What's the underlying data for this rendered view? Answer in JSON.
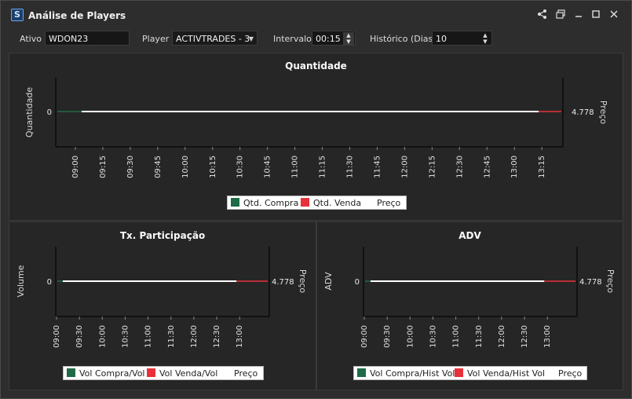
{
  "window": {
    "title": "Análise de Players"
  },
  "toolbar": {
    "ativo_label": "Ativo",
    "ativo_value": "WDON23",
    "player_label": "Player",
    "player_value": "ACTIVTRADES - 3",
    "intervalo_label": "Intervalo",
    "intervalo_value": "00:15",
    "historico_label": "Histórico (Dias)",
    "historico_value": "10"
  },
  "colors": {
    "compra": "#1e6b47",
    "venda": "#e8303a",
    "preco": "#ffffff"
  },
  "chart_data": [
    {
      "type": "line",
      "title": "Quantidade",
      "ylabel": "Quantidade",
      "y2label": "Preço",
      "y_tick": "0",
      "price_tick": "4.778",
      "x": [
        "09:00",
        "09:15",
        "09:30",
        "09:45",
        "10:00",
        "10:15",
        "10:30",
        "10:45",
        "11:00",
        "11:15",
        "11:30",
        "11:45",
        "12:00",
        "12:15",
        "12:30",
        "12:45",
        "13:00",
        "13:15"
      ],
      "series": [
        {
          "name": "Qtd. Compra",
          "values": [
            0,
            0,
            0,
            0,
            0,
            0,
            0,
            0,
            0,
            0,
            0,
            0,
            0,
            0,
            0,
            0,
            0,
            0
          ]
        },
        {
          "name": "Qtd. Venda",
          "values": [
            0,
            0,
            0,
            0,
            0,
            0,
            0,
            0,
            0,
            0,
            0,
            0,
            0,
            0,
            0,
            0,
            0,
            0
          ]
        },
        {
          "name": "Preço",
          "values": [
            4.778,
            4.778,
            4.778,
            4.778,
            4.778,
            4.778,
            4.778,
            4.778,
            4.778,
            4.778,
            4.778,
            4.778,
            4.778,
            4.778,
            4.778,
            4.778,
            4.778,
            4.778
          ]
        }
      ]
    },
    {
      "type": "line",
      "title": "Tx. Participação",
      "ylabel": "Volume",
      "y2label": "Preço",
      "y_tick": "0",
      "price_tick": "4.778",
      "x": [
        "09:00",
        "09:30",
        "10:00",
        "10:30",
        "11:00",
        "11:30",
        "12:00",
        "12:30",
        "13:00"
      ],
      "series": [
        {
          "name": "Vol Compra/Vol",
          "values": [
            0,
            0,
            0,
            0,
            0,
            0,
            0,
            0,
            0
          ]
        },
        {
          "name": "Vol Venda/Vol",
          "values": [
            0,
            0,
            0,
            0,
            0,
            0,
            0,
            0,
            0
          ]
        },
        {
          "name": "Preço",
          "values": [
            4.778,
            4.778,
            4.778,
            4.778,
            4.778,
            4.778,
            4.778,
            4.778,
            4.778
          ]
        }
      ]
    },
    {
      "type": "line",
      "title": "ADV",
      "ylabel": "ADV",
      "y2label": "Preço",
      "y_tick": "0",
      "price_tick": "4.778",
      "x": [
        "09:00",
        "09:30",
        "10:00",
        "10:30",
        "11:00",
        "11:30",
        "12:00",
        "12:30",
        "13:00"
      ],
      "series": [
        {
          "name": "Vol Compra/Hist Vol",
          "values": [
            0,
            0,
            0,
            0,
            0,
            0,
            0,
            0,
            0
          ]
        },
        {
          "name": "Vol Venda/Hist Vol",
          "values": [
            0,
            0,
            0,
            0,
            0,
            0,
            0,
            0,
            0
          ]
        },
        {
          "name": "Preço",
          "values": [
            4.778,
            4.778,
            4.778,
            4.778,
            4.778,
            4.778,
            4.778,
            4.778,
            4.778
          ]
        }
      ]
    }
  ]
}
